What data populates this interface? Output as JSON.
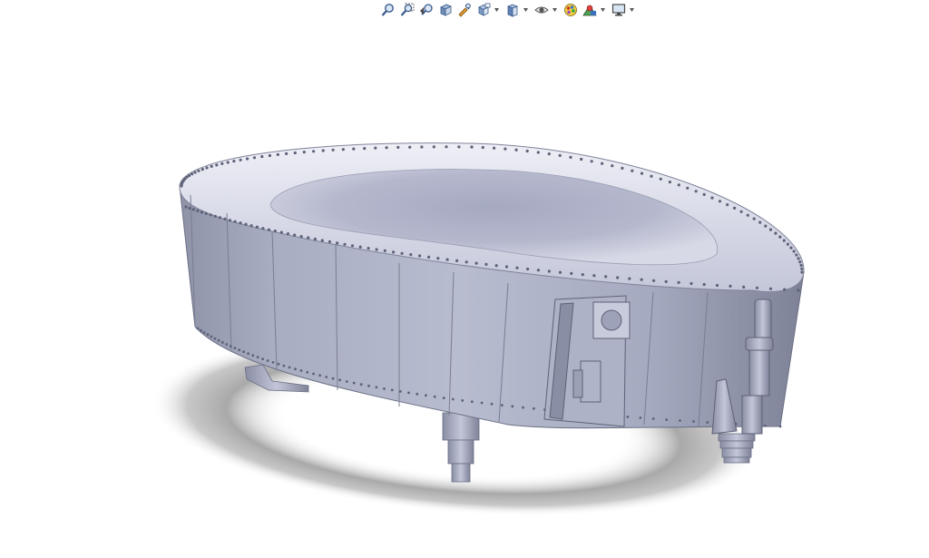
{
  "viewport": {
    "background": "#ffffff",
    "model_color": "#b4b8cc",
    "shadow_color": "#9a9a9a"
  },
  "hud_toolbar": {
    "buttons": [
      {
        "id": "zoom-to-fit",
        "icon": "zoom-to-fit-icon",
        "has_dropdown": false
      },
      {
        "id": "zoom-to-area",
        "icon": "zoom-to-area-icon",
        "has_dropdown": false
      },
      {
        "id": "previous-view",
        "icon": "previous-view-icon",
        "has_dropdown": false
      },
      {
        "id": "section-view",
        "icon": "section-view-icon",
        "has_dropdown": false
      },
      {
        "id": "dynamic-annotation",
        "icon": "dynamic-annotation-icon",
        "has_dropdown": false
      },
      {
        "id": "view-orientation",
        "icon": "view-orientation-icon",
        "has_dropdown": true
      },
      {
        "id": "display-style",
        "icon": "display-style-icon",
        "has_dropdown": true
      },
      {
        "id": "hide-show-items",
        "icon": "hide-show-items-icon",
        "has_dropdown": true
      },
      {
        "id": "edit-appearance",
        "icon": "edit-appearance-icon",
        "has_dropdown": false
      },
      {
        "id": "apply-scene",
        "icon": "apply-scene-icon",
        "has_dropdown": true
      },
      {
        "id": "view-settings",
        "icon": "view-settings-icon",
        "has_dropdown": true
      }
    ]
  }
}
